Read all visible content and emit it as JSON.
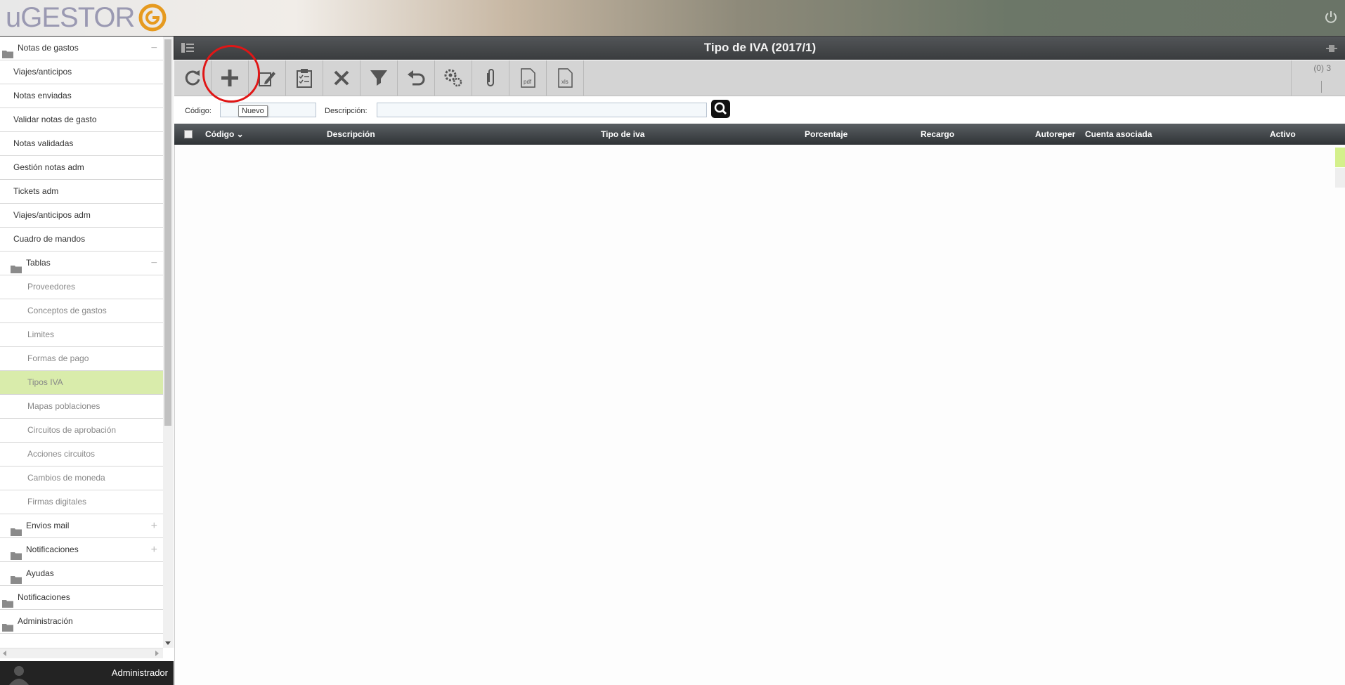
{
  "app": {
    "logo_text": "uGESTOR"
  },
  "window": {
    "title": "Tipo de IVA (2017/1)"
  },
  "sidebar": {
    "items": [
      {
        "type": "folder",
        "level": 0,
        "label": "Notas de gastos",
        "toggle": "−"
      },
      {
        "type": "link",
        "level": 1,
        "label": "Viajes/anticipos"
      },
      {
        "type": "link",
        "level": 1,
        "label": "Notas enviadas"
      },
      {
        "type": "link",
        "level": 1,
        "label": "Validar notas de gasto"
      },
      {
        "type": "link",
        "level": 1,
        "label": "Notas validadas"
      },
      {
        "type": "link",
        "level": 1,
        "label": "Gestión notas adm"
      },
      {
        "type": "link",
        "level": 1,
        "label": "Tickets adm"
      },
      {
        "type": "link",
        "level": 1,
        "label": "Viajes/anticipos adm"
      },
      {
        "type": "link",
        "level": 1,
        "label": "Cuadro de mandos"
      },
      {
        "type": "folder",
        "level": 1,
        "label": "Tablas",
        "toggle": "−"
      },
      {
        "type": "link",
        "level": 2,
        "label": "Proveedores"
      },
      {
        "type": "link",
        "level": 2,
        "label": "Conceptos de gastos"
      },
      {
        "type": "link",
        "level": 2,
        "label": "Limites"
      },
      {
        "type": "link",
        "level": 2,
        "label": "Formas de pago"
      },
      {
        "type": "link",
        "level": 2,
        "label": "Tipos IVA",
        "selected": true
      },
      {
        "type": "link",
        "level": 2,
        "label": "Mapas poblaciones"
      },
      {
        "type": "link",
        "level": 2,
        "label": "Circuitos de aprobación"
      },
      {
        "type": "link",
        "level": 2,
        "label": "Acciones circuitos"
      },
      {
        "type": "link",
        "level": 2,
        "label": "Cambios de moneda"
      },
      {
        "type": "link",
        "level": 2,
        "label": "Firmas digitales"
      },
      {
        "type": "folder",
        "level": 1,
        "label": "Envios mail",
        "toggle": "+"
      },
      {
        "type": "folder",
        "level": 1,
        "label": "Notificaciones",
        "toggle": "+"
      },
      {
        "type": "folder",
        "level": 1,
        "label": "Ayudas",
        "toggle": ""
      },
      {
        "type": "folder",
        "level": 0,
        "label": "Notificaciones",
        "toggle": ""
      },
      {
        "type": "folder",
        "level": 0,
        "label": "Administración",
        "toggle": ""
      }
    ],
    "user": "Administrador"
  },
  "toolbar": {
    "buttons": [
      {
        "name": "refresh",
        "icon": "refresh-icon"
      },
      {
        "name": "new",
        "icon": "plus-icon",
        "tooltip": "Nuevo"
      },
      {
        "name": "edit",
        "icon": "edit-icon"
      },
      {
        "name": "clipboard",
        "icon": "clipboard-check-icon"
      },
      {
        "name": "delete",
        "icon": "close-icon"
      },
      {
        "name": "filter",
        "icon": "filter-icon"
      },
      {
        "name": "undo",
        "icon": "undo-icon"
      },
      {
        "name": "settings",
        "icon": "gears-icon"
      },
      {
        "name": "attach",
        "icon": "paperclip-icon"
      },
      {
        "name": "pdf",
        "icon": "pdf-file-icon",
        "label": "pdf"
      },
      {
        "name": "xls",
        "icon": "xls-file-icon",
        "label": "xls"
      }
    ],
    "counter": "(0) 3"
  },
  "filters": {
    "codigo_label": "Código:",
    "codigo_value": "",
    "descripcion_label": "Descripción:",
    "descripcion_value": ""
  },
  "tooltip": "Nuevo",
  "grid": {
    "columns": [
      "Código",
      "Descripción",
      "Tipo de iva",
      "Porcentaje",
      "Recargo",
      "Autoreper",
      "Cuenta asociada",
      "Activo"
    ],
    "sort_indicator": "⌄",
    "rows": []
  },
  "colors": {
    "selected_bg": "#d9ecab",
    "highlight": "#e01616",
    "accent": "#d4f08c"
  }
}
